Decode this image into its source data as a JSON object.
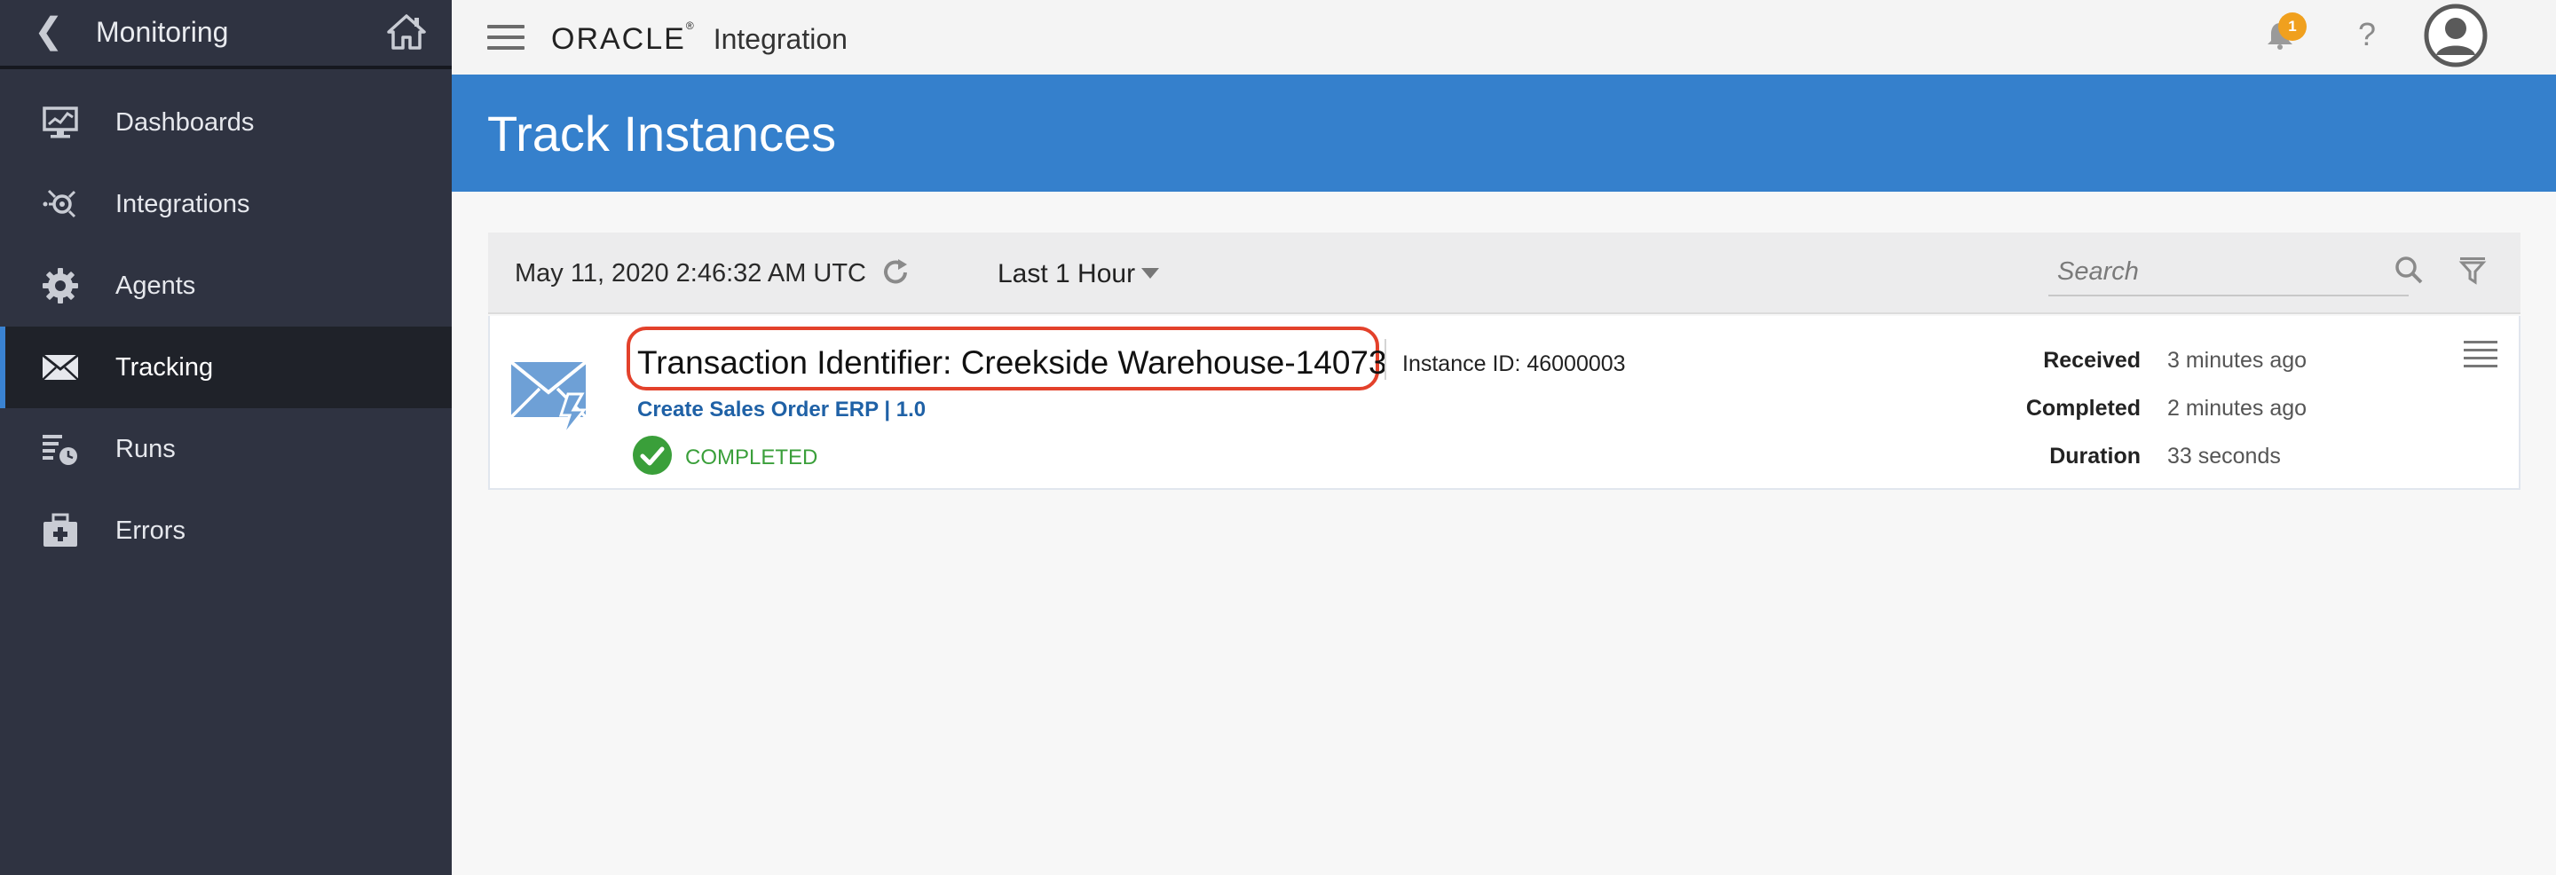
{
  "sidebar": {
    "title": "Monitoring",
    "items": [
      {
        "label": "Dashboards",
        "icon": "dashboard-monitor-icon"
      },
      {
        "label": "Integrations",
        "icon": "integrations-icon"
      },
      {
        "label": "Agents",
        "icon": "gear-icon"
      },
      {
        "label": "Tracking",
        "icon": "envelope-icon",
        "active": true
      },
      {
        "label": "Runs",
        "icon": "runs-list-icon"
      },
      {
        "label": "Errors",
        "icon": "toolbox-icon"
      }
    ]
  },
  "topbar": {
    "brand_oracle": "ORACLE",
    "brand_reg": "®",
    "brand_product": "Integration",
    "notification_count": "1",
    "help_label": "?"
  },
  "page": {
    "title": "Track Instances"
  },
  "filters": {
    "datestamp": "May 11, 2020 2:46:32 AM UTC",
    "time_range": "Last 1 Hour",
    "search_placeholder": "Search"
  },
  "instance": {
    "transaction_label": "Transaction Identifier: Creekside Warehouse-14073",
    "instance_id": "Instance ID: 46000003",
    "flow_name": "Create Sales Order ERP | 1.0",
    "status": "COMPLETED",
    "received_label": "Received",
    "received_value": "3 minutes ago",
    "completed_label": "Completed",
    "completed_value": "2 minutes ago",
    "duration_label": "Duration",
    "duration_value": "33 seconds"
  },
  "colors": {
    "sidebar_bg": "#2f3341",
    "active_item_bg": "#1f2229",
    "accent_blue": "#3580cc",
    "link_blue": "#1f61a6",
    "highlight_red": "#e3412b",
    "status_green": "#3a9f3a",
    "badge_orange": "#f0a01e"
  }
}
